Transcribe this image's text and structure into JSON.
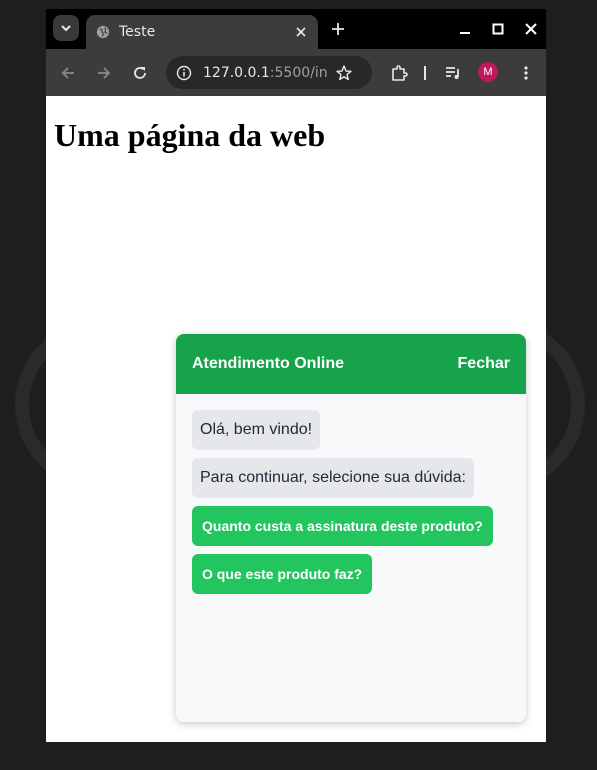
{
  "browser": {
    "tab_title": "Teste",
    "url_host": "127.0.0.1",
    "url_path": ":5500/in...",
    "profile_initial": "M"
  },
  "page": {
    "title": "Uma página da web"
  },
  "chat": {
    "title": "Atendimento Online",
    "close_label": "Fechar",
    "messages": [
      "Olá, bem vindo!",
      "Para continuar, selecione sua dúvida:"
    ],
    "options": [
      "Quanto custa a assinatura deste produto?",
      "O que este produto faz?"
    ],
    "header_color": "#17a34a",
    "option_color": "#22c55e"
  }
}
